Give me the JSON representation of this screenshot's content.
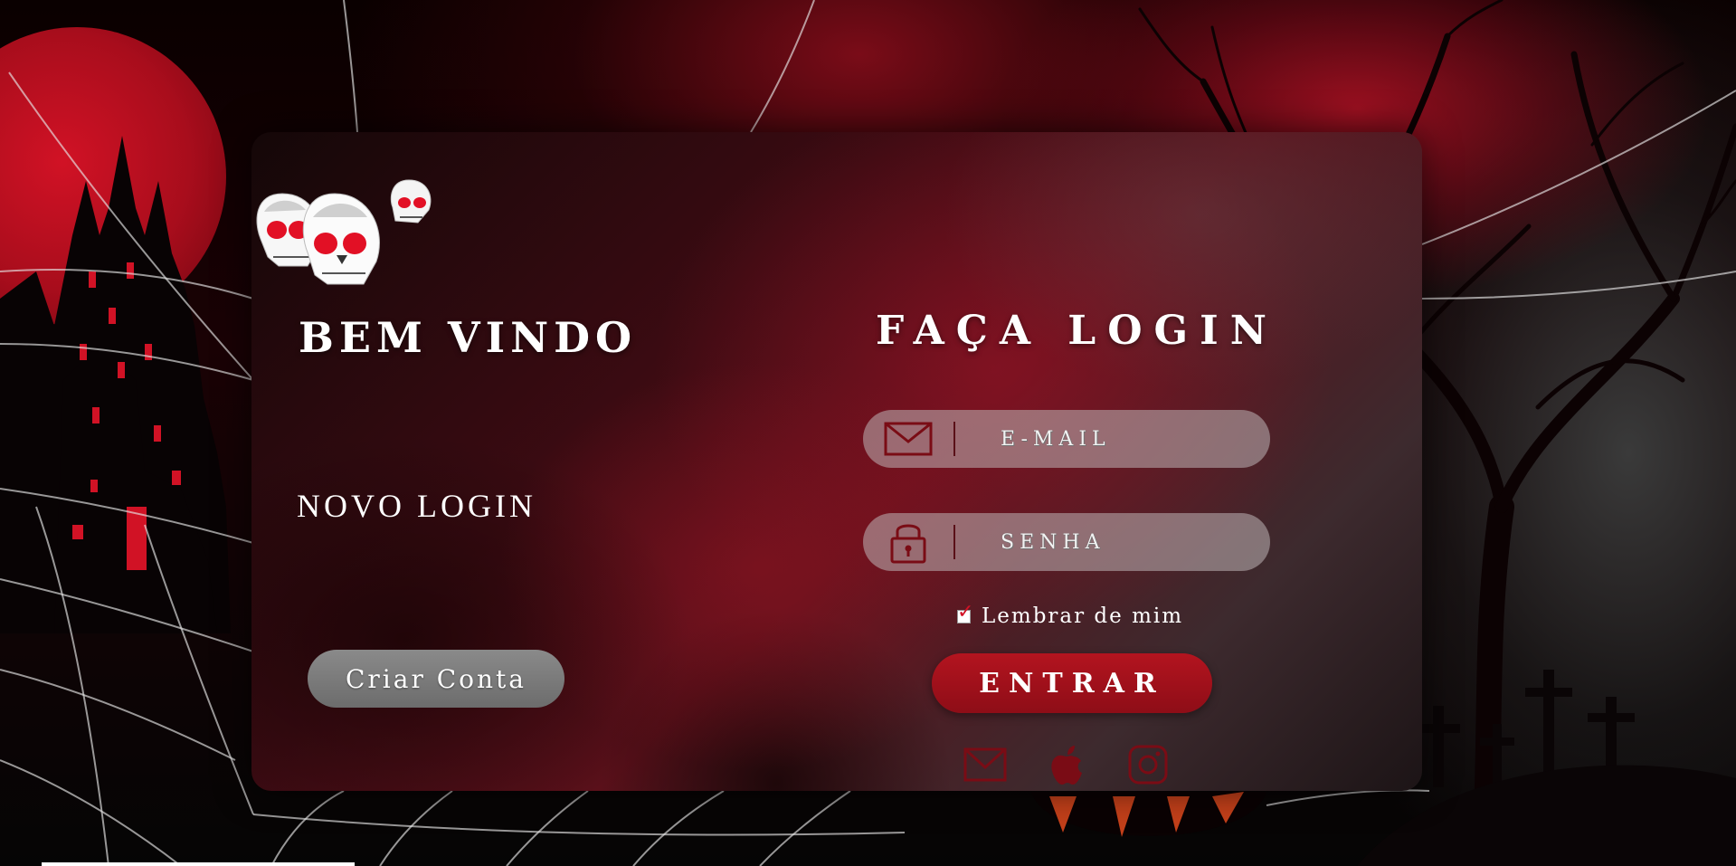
{
  "welcome": {
    "title": "BEM VINDO",
    "subtitle": "NOVO LOGIN",
    "create_account_label": "Criar Conta"
  },
  "login": {
    "title": "FAÇA LOGIN",
    "email": {
      "placeholder": "E-MAIL",
      "icon": "envelope-icon"
    },
    "password": {
      "placeholder": "SENHA",
      "icon": "padlock-icon"
    },
    "remember_label": "Lembrar de mim",
    "remember_checked": true,
    "submit_label": "ENTRAR"
  },
  "socials": [
    {
      "name": "email",
      "icon": "mail-icon"
    },
    {
      "name": "apple",
      "icon": "apple-icon"
    },
    {
      "name": "instagram",
      "icon": "instagram-icon"
    }
  ],
  "colors": {
    "accent": "#b3141f",
    "icon": "#7a0c15",
    "panel_text": "#ffffff"
  }
}
